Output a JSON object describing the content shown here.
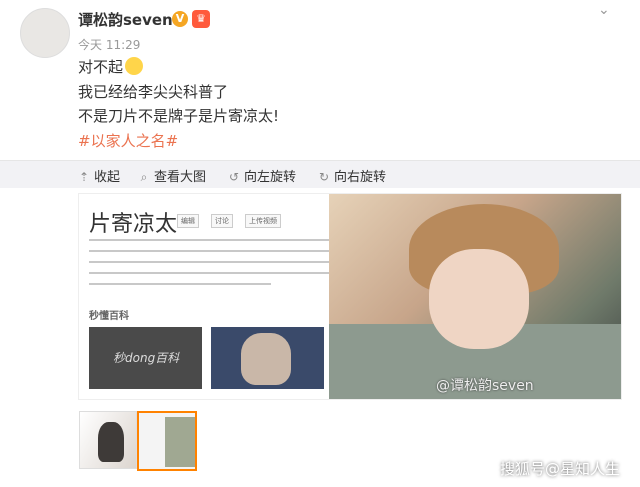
{
  "post": {
    "username": "谭松韵seven",
    "v_badge": "V",
    "crown": "♛",
    "time": "今天 11:29",
    "lines": [
      "对不起",
      "我已经给李尖尖科普了",
      "不是刀片不是牌子是片寄凉太!"
    ],
    "hashtag": "#以家人之名#"
  },
  "toolbar": {
    "collapse": {
      "label": "收起",
      "icon": "collapse-icon"
    },
    "view_large": {
      "label": "查看大图",
      "icon": "search-icon"
    },
    "rotate_left": {
      "label": "向左旋转",
      "icon": "rotate-left-icon"
    },
    "rotate_right": {
      "label": "向右旋转",
      "icon": "rotate-right-icon"
    }
  },
  "main_image": {
    "title": "片寄凉太",
    "buttons": [
      "编辑",
      "讨论",
      "上传视频"
    ],
    "logo_text": "秒懂百科",
    "card_text": "秒dong百科"
  },
  "watermark": "@谭松韵seven",
  "footer": "搜狐号@星知人生"
}
